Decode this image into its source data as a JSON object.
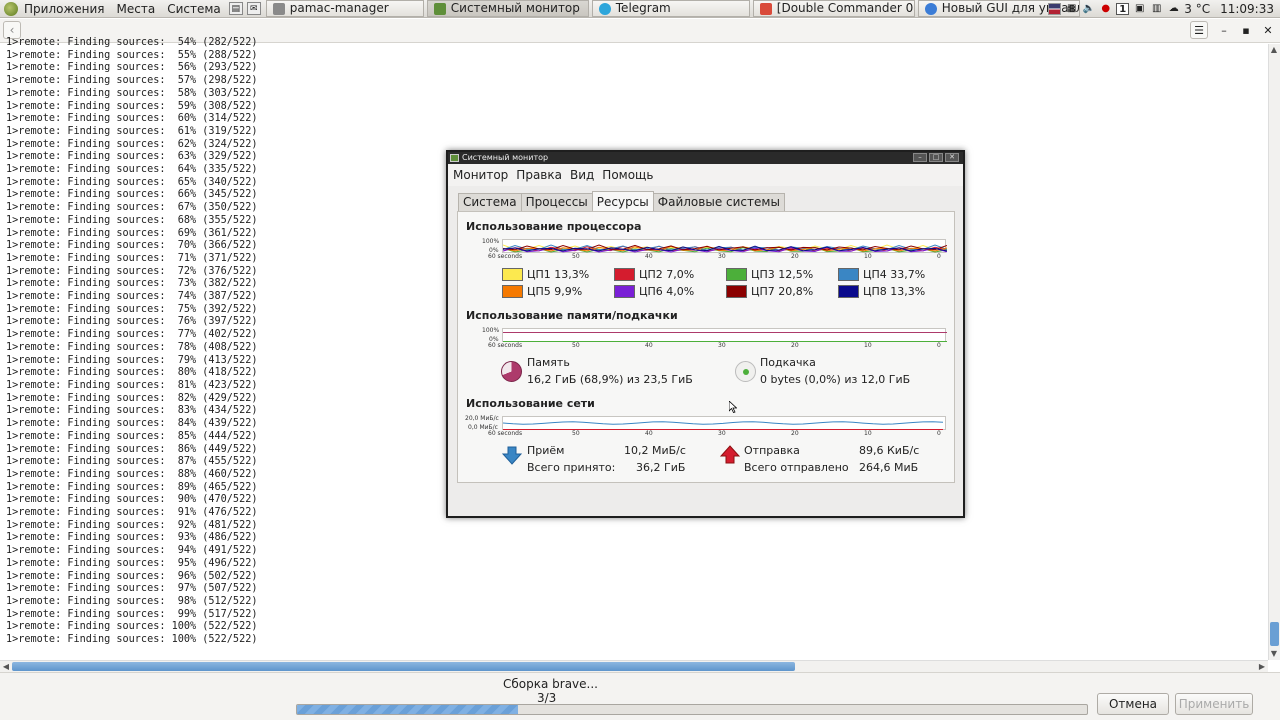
{
  "topbar": {
    "menus": [
      "Приложения",
      "Места",
      "Система"
    ],
    "tasks": [
      {
        "label": "pamac-manager",
        "color": "#8a8a8a"
      },
      {
        "label": "Системный монитор",
        "color": "#5f8f3a"
      },
      {
        "label": "Telegram",
        "color": "#2ea6db"
      },
      {
        "label": "[Double Commander 0....",
        "color": "#d94a3a"
      },
      {
        "label": "Новый GUI для управл...",
        "color": "#3b7cd6"
      }
    ],
    "weather": "3 °C",
    "clock": "11:09:33"
  },
  "log_lines": [
    "1>remote: Finding sources:  54% (282/522)",
    "1>remote: Finding sources:  55% (288/522)",
    "1>remote: Finding sources:  56% (293/522)",
    "1>remote: Finding sources:  57% (298/522)",
    "1>remote: Finding sources:  58% (303/522)",
    "1>remote: Finding sources:  59% (308/522)",
    "1>remote: Finding sources:  60% (314/522)",
    "1>remote: Finding sources:  61% (319/522)",
    "1>remote: Finding sources:  62% (324/522)",
    "1>remote: Finding sources:  63% (329/522)",
    "1>remote: Finding sources:  64% (335/522)",
    "1>remote: Finding sources:  65% (340/522)",
    "1>remote: Finding sources:  66% (345/522)",
    "1>remote: Finding sources:  67% (350/522)",
    "1>remote: Finding sources:  68% (355/522)",
    "1>remote: Finding sources:  69% (361/522)",
    "1>remote: Finding sources:  70% (366/522)",
    "1>remote: Finding sources:  71% (371/522)",
    "1>remote: Finding sources:  72% (376/522)",
    "1>remote: Finding sources:  73% (382/522)",
    "1>remote: Finding sources:  74% (387/522)",
    "1>remote: Finding sources:  75% (392/522)",
    "1>remote: Finding sources:  76% (397/522)",
    "1>remote: Finding sources:  77% (402/522)",
    "1>remote: Finding sources:  78% (408/522)",
    "1>remote: Finding sources:  79% (413/522)",
    "1>remote: Finding sources:  80% (418/522)",
    "1>remote: Finding sources:  81% (423/522)",
    "1>remote: Finding sources:  82% (429/522)",
    "1>remote: Finding sources:  83% (434/522)",
    "1>remote: Finding sources:  84% (439/522)",
    "1>remote: Finding sources:  85% (444/522)",
    "1>remote: Finding sources:  86% (449/522)",
    "1>remote: Finding sources:  87% (455/522)",
    "1>remote: Finding sources:  88% (460/522)",
    "1>remote: Finding sources:  89% (465/522)",
    "1>remote: Finding sources:  90% (470/522)",
    "1>remote: Finding sources:  91% (476/522)",
    "1>remote: Finding sources:  92% (481/522)",
    "1>remote: Finding sources:  93% (486/522)",
    "1>remote: Finding sources:  94% (491/522)",
    "1>remote: Finding sources:  95% (496/522)",
    "1>remote: Finding sources:  96% (502/522)",
    "1>remote: Finding sources:  97% (507/522)",
    "1>remote: Finding sources:  98% (512/522)",
    "1>remote: Finding sources:  99% (517/522)",
    "1>remote: Finding sources: 100% (522/522)",
    "1>remote: Finding sources: 100% (522/522)"
  ],
  "bottom": {
    "status": "Сборка brave...",
    "count": "3/3",
    "progress_fraction": 0.28,
    "cancel_label": "Отмена",
    "apply_label": "Применить"
  },
  "sysmon": {
    "title": "Системный монитор",
    "menu": [
      "Монитор",
      "Правка",
      "Вид",
      "Помощь"
    ],
    "tabs": [
      "Система",
      "Процессы",
      "Ресурсы",
      "Файловые системы"
    ],
    "active_tab": 2,
    "cpu_title": "Использование процессора",
    "mem_title": "Использование памяти/подкачки",
    "net_title": "Использование сети",
    "graph_top_label": "100%",
    "graph_bottom_label": "0%",
    "net_top_label": "20,0 МиБ/с",
    "net_bottom_label": "0,0 МиБ/с",
    "x_ticks": [
      "60 seconds",
      "50",
      "40",
      "30",
      "20",
      "10",
      "0"
    ],
    "cpus": [
      {
        "label": "ЦП1 13,3%",
        "color": "#fce94f"
      },
      {
        "label": "ЦП2 7,0%",
        "color": "#d41c2e"
      },
      {
        "label": "ЦП3 12,5%",
        "color": "#4caf3a"
      },
      {
        "label": "ЦП4 33,7%",
        "color": "#3a86c4"
      },
      {
        "label": "ЦП5 9,9%",
        "color": "#f57900"
      },
      {
        "label": "ЦП6 4,0%",
        "color": "#7a1fd6"
      },
      {
        "label": "ЦП7 20,8%",
        "color": "#8b0000"
      },
      {
        "label": "ЦП8 13,3%",
        "color": "#0a0a8c"
      }
    ],
    "memory": {
      "label": "Память",
      "value": "16,2 ГиБ (68,9%) из 23,5 ГиБ",
      "fraction": 0.689,
      "color": "#ad3a6b"
    },
    "swap": {
      "label": "Подкачка",
      "value": "0 bytes (0,0%) из 12,0 ГиБ",
      "fraction": 0.0,
      "color": "#4caf3a"
    },
    "network": {
      "recv_label": "Приём",
      "recv_rate": "10,2 МиБ/с",
      "recv_total_label": "Всего принято:",
      "recv_total": "36,2 ГиБ",
      "send_label": "Отправка",
      "send_rate": "89,6 КиБ/с",
      "send_total_label": "Всего отправлено",
      "send_total": "264,6 МиБ",
      "recv_color": "#3a86c4",
      "send_color": "#d41c2e"
    }
  }
}
